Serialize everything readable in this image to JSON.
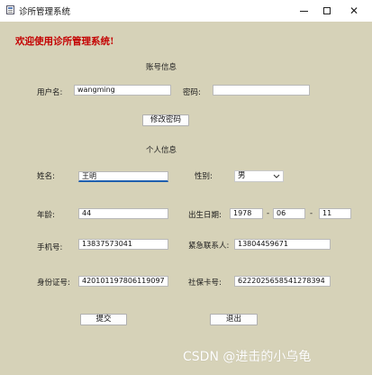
{
  "window": {
    "title": "诊所管理系统",
    "minimize_icon": "minimize-icon",
    "maximize_icon": "maximize-icon",
    "close_icon": "close-icon",
    "close_glyph": "✕"
  },
  "welcome": "欢迎使用诊所管理系统!",
  "account": {
    "section_title": "账号信息",
    "username_label": "用户名:",
    "username_value": "wangming",
    "password_label": "密码:",
    "password_value": "",
    "change_password_button": "修改密码"
  },
  "personal": {
    "section_title": "个人信息",
    "name_label": "姓名:",
    "name_value": "王明",
    "gender_label": "性别:",
    "gender_value": "男",
    "age_label": "年龄:",
    "age_value": "44",
    "birthdate_label": "出生日期:",
    "birth_year": "1978",
    "birth_month": "06",
    "birth_day": "11",
    "date_separator": "-",
    "phone_label": "手机号:",
    "phone_value": "13837573041",
    "emergency_label": "紧急联系人:",
    "emergency_value": "13804459671",
    "id_label": "身份证号:",
    "id_value": "420101197806119097",
    "social_label": "社保卡号:",
    "social_value": "6222025658541278394"
  },
  "actions": {
    "submit_button": "提交",
    "exit_button": "退出"
  },
  "watermark": "CSDN @进击的小乌龟"
}
